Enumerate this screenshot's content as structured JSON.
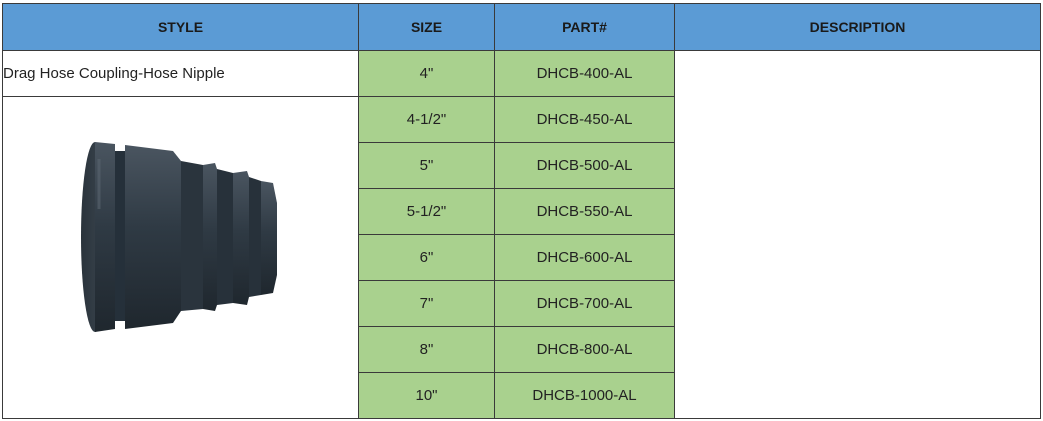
{
  "headers": {
    "style": "STYLE",
    "size": "SIZE",
    "part": "PART#",
    "description": "DESCRIPTION"
  },
  "style_name": "Drag Hose Coupling-Hose Nipple",
  "product_image_icon": "hose-nipple-coupling-image",
  "colors": {
    "header_bg": "#5b9bd5",
    "cell_green": "#a9d18e",
    "product": "#2f3a44"
  },
  "rows": [
    {
      "size": "4\"",
      "part": "DHCB-400-AL"
    },
    {
      "size": "4-1/2\"",
      "part": "DHCB-450-AL"
    },
    {
      "size": "5\"",
      "part": "DHCB-500-AL"
    },
    {
      "size": "5-1/2\"",
      "part": "DHCB-550-AL"
    },
    {
      "size": "6\"",
      "part": "DHCB-600-AL"
    },
    {
      "size": "7\"",
      "part": "DHCB-700-AL"
    },
    {
      "size": "8\"",
      "part": "DHCB-800-AL"
    },
    {
      "size": "10\"",
      "part": "DHCB-1000-AL"
    }
  ]
}
